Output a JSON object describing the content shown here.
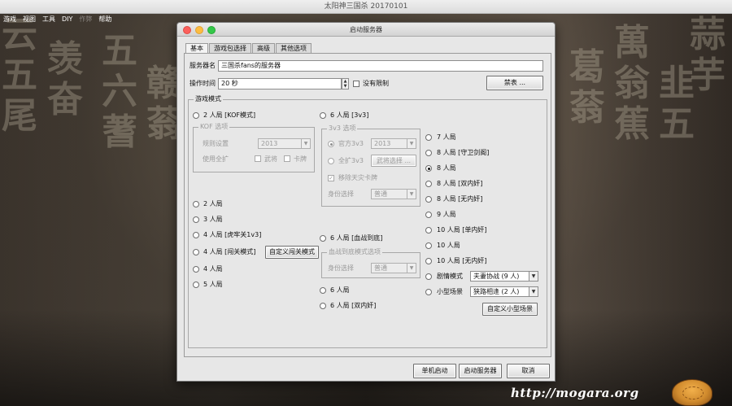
{
  "app": {
    "title": "太阳神三国杀 20170101",
    "menu": [
      "游戏",
      "视图",
      "工具",
      "DIY",
      "作弊",
      "帮助"
    ]
  },
  "dialog": {
    "title": "启动服务器",
    "tabs": [
      "基本",
      "游戏包选择",
      "高级",
      "其他选项"
    ],
    "server_name_label": "服务器名",
    "server_name_value": "三国杀fans的服务器",
    "op_time_label": "操作时间",
    "op_time_value": "20 秒",
    "no_limit_label": "没有限制",
    "ban_list_button": "禁表 ...",
    "mode_group_title": "游戏模式",
    "col1": {
      "r2_kof": "2 人局 [KOF模式]",
      "kof_group_title": "KOF 选项",
      "rule_label": "规则设置",
      "rule_value": "2013",
      "use_ext_label": "使用全扩",
      "wujiang_label": "武将",
      "kapai_label": "卡牌",
      "r2": "2 人局",
      "r3": "3 人局",
      "r4_hulao": "4 人局 [虎牢关1v3]",
      "r4_chuangguan": "4 人局 [闯关模式]",
      "custom_chuangguan_button": "自定义闯关模式",
      "r4": "4 人局",
      "r5": "5 人局"
    },
    "col2": {
      "r6_3v3": "6 人局 [3v3]",
      "g3v3_title": "3v3 选项",
      "official": "官方3v3",
      "official_select": "2013",
      "full_ext": "全扩3v3",
      "general_select_button": "武将选择 ...",
      "remove_card_label": "移除天灾卡牌",
      "role_select_label": "身份选择",
      "role_select_value": "普通",
      "r6_yiji": "6 人局 [血战到底]",
      "yiji_group_title": "血战到底模式选项",
      "yiji_role_label": "身份选择",
      "yiji_role_value": "普通",
      "r6": "6 人局",
      "r6_double": "6 人局 [双内奸]"
    },
    "col3": {
      "items": [
        "7 人局",
        "8 人局 [守卫剑阁]",
        "8 人局",
        "8 人局 [双内奸]",
        "8 人局 [无内奸]",
        "9 人局",
        "10 人局 [单内奸]",
        "10 人局",
        "10 人局 [无内奸]"
      ],
      "scenario_label": "剧情模式",
      "scenario_value": "夫妻协战 (9 人)",
      "mini_label": "小型场景",
      "mini_value": "狭路相逢 (2 人)",
      "custom_mini_button": "自定义小型场景"
    },
    "buttons": {
      "standalone": "单机启动",
      "start_server": "启动服务器",
      "cancel": "取消"
    }
  },
  "watermark": "http://mogara.org",
  "background_glyphs": [
    "云五尾",
    "羡奋",
    "五六蓍",
    "赣蓊",
    "葛蓊",
    "萬翁蕉",
    "韭五",
    "蒜芋"
  ]
}
